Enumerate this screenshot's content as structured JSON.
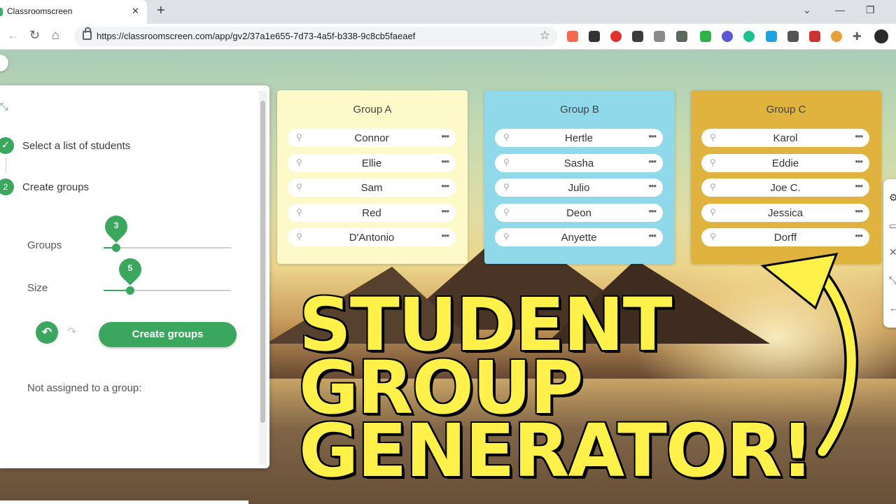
{
  "browser": {
    "tab_title": "Classroomscreen",
    "tab_close": "✕",
    "new_tab": "+",
    "url": "https://classroomscreen.com/app/gv2/37a1e655-7d73-4a5f-b338-9c8cb5faeaef",
    "controls": {
      "dropdown": "⌄",
      "minimize": "—",
      "restore": "❐"
    }
  },
  "panel": {
    "step1_label": "Select a list of students",
    "step2_number": "2",
    "step2_label": "Create groups",
    "groups_label": "Groups",
    "groups_value": "3",
    "groups_fraction": 0.1,
    "size_label": "Size",
    "size_value": "5",
    "size_fraction": 0.21,
    "create_button": "Create groups",
    "unassigned_label": "Not assigned to a group:"
  },
  "groups": [
    {
      "name": "Group A",
      "color": "#fdf9c8",
      "members": [
        "Connor",
        "Ellie",
        "Sam",
        "Red",
        "D'Antonio"
      ]
    },
    {
      "name": "Group B",
      "color": "#8fd9ea",
      "members": [
        "Hertle",
        "Sasha",
        "Julio",
        "Deon",
        "Anyette"
      ]
    },
    {
      "name": "Group C",
      "color": "#e0b33e",
      "members": [
        "Karol",
        "Eddie",
        "Joe C.",
        "Jessica",
        "Dorff"
      ]
    }
  ],
  "headline": {
    "line1": "STUDENT",
    "line2": "GROUP",
    "line3": "GENERATOR!"
  },
  "colors": {
    "accent": "#3ba65e",
    "headline": "#fff04a"
  },
  "icons": {
    "pin": "pin-icon",
    "more": "more-dots-icon",
    "check": "check-icon",
    "undo": "undo-icon",
    "redo": "redo-icon"
  }
}
